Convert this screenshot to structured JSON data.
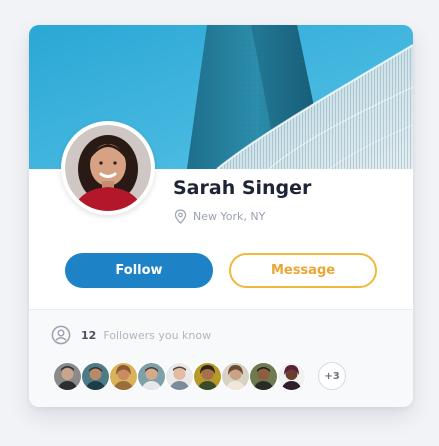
{
  "profile": {
    "name": "Sarah Singer",
    "location": "New York, NY"
  },
  "actions": {
    "follow_label": "Follow",
    "message_label": "Message"
  },
  "followers": {
    "count": "12",
    "label": "Followers you know",
    "more_label": "+3"
  },
  "icons": {
    "location": "map-pin-icon",
    "followers": "user-circle-icon"
  },
  "colors": {
    "primary": "#1e82c7",
    "accent": "#f0b93a",
    "name_text": "#1d2436",
    "muted_text": "#9aa1ad"
  }
}
